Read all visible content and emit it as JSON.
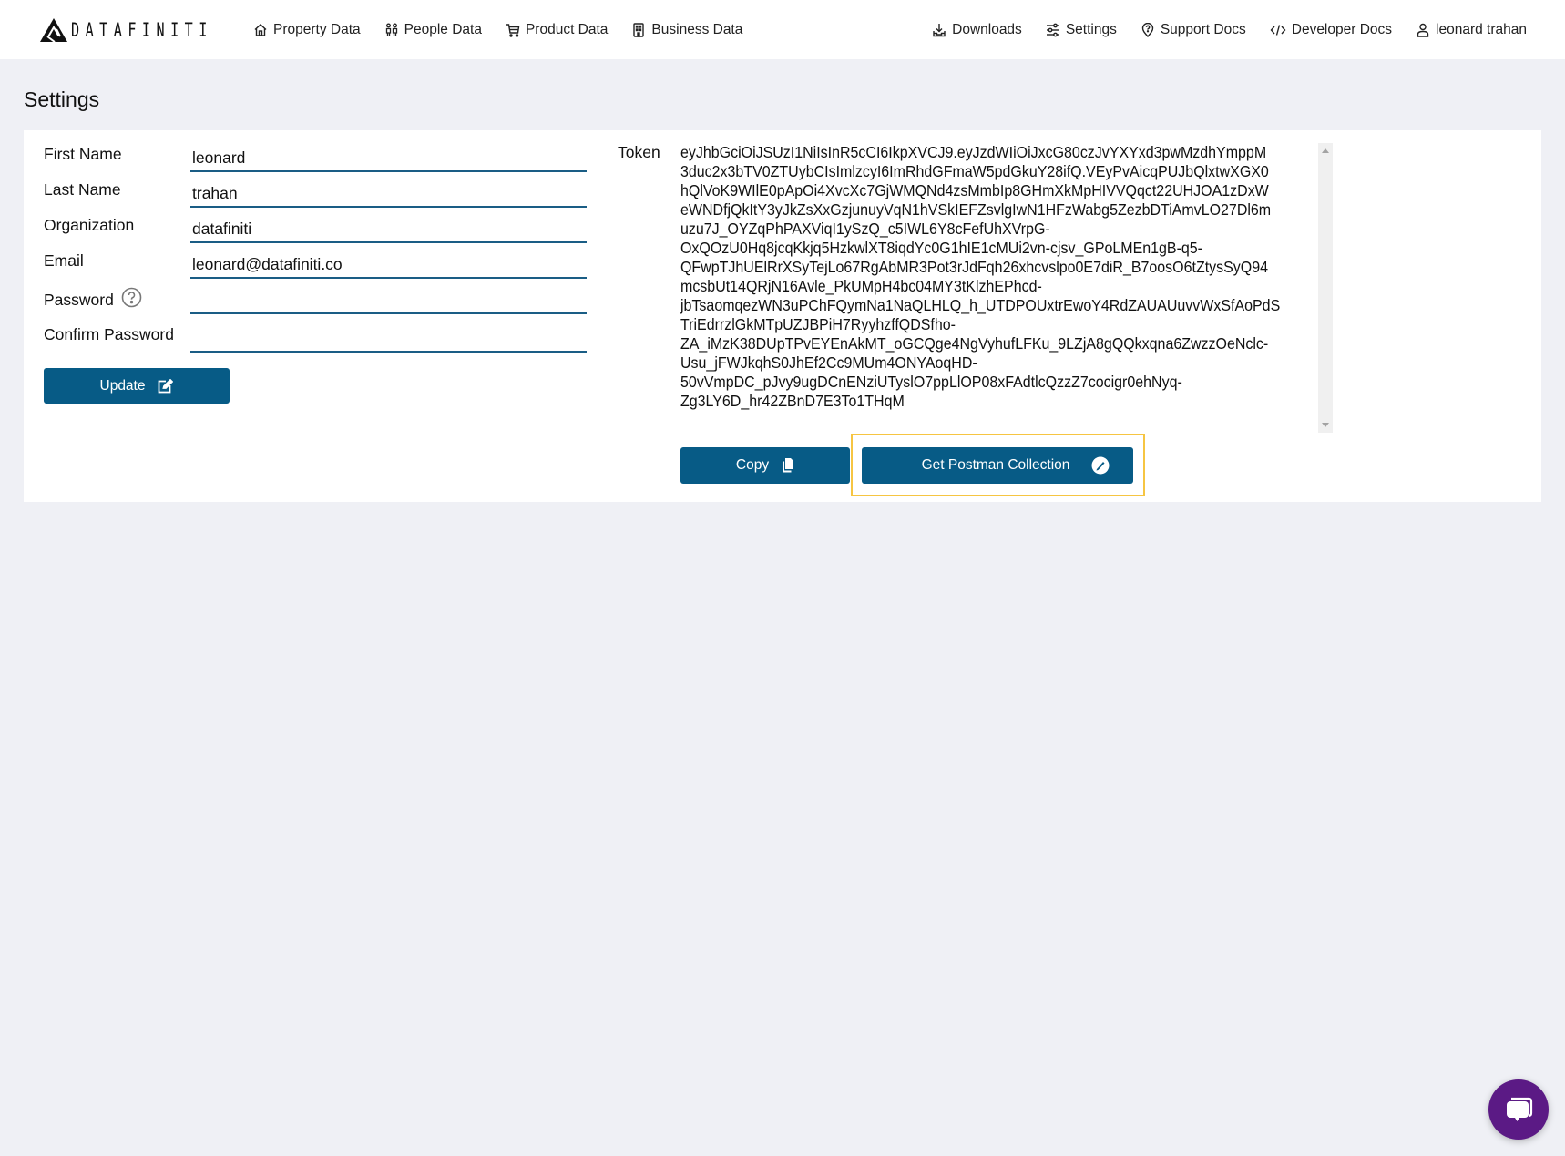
{
  "brand": {
    "name": "DATAFINITI"
  },
  "nav": {
    "left": [
      {
        "label": "Property Data",
        "icon": "home-icon"
      },
      {
        "label": "People Data",
        "icon": "people-icon"
      },
      {
        "label": "Product Data",
        "icon": "cart-icon"
      },
      {
        "label": "Business Data",
        "icon": "building-icon"
      }
    ],
    "right": [
      {
        "label": "Downloads",
        "icon": "download-icon"
      },
      {
        "label": "Settings",
        "icon": "sliders-icon"
      },
      {
        "label": "Support Docs",
        "icon": "support-pin-icon"
      },
      {
        "label": "Developer Docs",
        "icon": "code-icon"
      },
      {
        "label": "leonard trahan",
        "icon": "user-icon"
      }
    ]
  },
  "page": {
    "title": "Settings"
  },
  "form": {
    "fields": [
      {
        "label": "First Name",
        "value": "leonard"
      },
      {
        "label": "Last Name",
        "value": "trahan"
      },
      {
        "label": "Organization",
        "value": "datafiniti"
      },
      {
        "label": "Email",
        "value": "leonard@datafiniti.co"
      },
      {
        "label": "Password",
        "value": ""
      },
      {
        "label": "Confirm Password",
        "value": ""
      }
    ],
    "update_label": "Update"
  },
  "token": {
    "label": "Token",
    "value": "eyJhbGciOiJSUzI1NiIsInR5cCI6IkpXVCJ9.eyJzdWIiOiJxcG80czJvYXYxd3pwMzdhYmppM3duc2x3bTV0ZTUybCIsImlzcyI6ImRhdGFmaW5pdGkuY28ifQ.VEyPvAicqPUJbQlxtwXGX0hQlVoK9WIlE0pApOi4XvcXc7GjWMQNd4zsMmbIp8GHmXkMpHIVVQqct22UHJOA1zDxWeWNDfjQkItY3yJkZsXxGzjunuyVqN1hVSkIEFZsvlgIwN1HFzWabg5ZezbDTiAmvLO27Dl6muzu7J_OYZqPhPAXViqI1ySzQ_c5IWL6Y8cFefUhXVrpG-OxQOzU0Hq8jcqKkjq5HzkwlXT8iqdYc0G1hIE1cMUi2vn-cjsv_GPoLMEn1gB-q5-QFwpTJhUElRrXSyTejLo67RgAbMR3Pot3rJdFqh26xhcvslpo0E7diR_B7oosO6tZtysSyQ94mcsbUt14QRjN16Avle_PkUMpH4bc04MY3tKlzhEPhcd-jbTsaomqezWN3uPChFQymNa1NaQLHLQ_h_UTDPOUxtrEwoY4RdZAUAUuvvWxSfAoPdSTriEdrrzlGkMTpUZJBPiH7RyyhzffQDSfho-ZA_iMzK38DUpTPvEYEnAkMT_oGCQge4NgVyhufLFKu_9LZjA8gQQkxqna6ZwzzOeNclc-Usu_jFWJkqhS0JhEf2Cc9MUm4ONYAoqHD-50vVmpDC_pJvy9ugDCnENziUTyslO7ppLlOP08xFAdtlcQzzZ7cocigr0ehNyq-Zg3LY6D_hr42ZBnD7E3To1THqM",
    "lines": [
      "eyJhbGciOiJSUzI1NiIsInR5cCI6IkpXVCJ9.eyJzdWIiOiJxcG80czJvYXYxd3pwMzdhYmppM",
      "3duc2x3bTV0ZTUybCIsImlzcyI6ImRhdGFmaW5pdGkuY28ifQ.VEyPvAicqPUJbQlxtwXGX0",
      "hQlVoK9WIlE0pApOi4XvcXc7GjWMQNd4zsMmbIp8GHmXkMpHIVVQqct22UHJOA1zDxW",
      "eWNDfjQkItY3yJkZsXxGzjunuyVqN1hVSkIEFZsvlgIwN1HFzWabg5ZezbDTiAmvLO27Dl6m",
      "uzu7J_OYZqPhPAXViqI1ySzQ_c5IWL6Y8cFefUhXVrpG-",
      "OxQOzU0Hq8jcqKkjq5HzkwlXT8iqdYc0G1hIE1cMUi2vn-cjsv_GPoLMEn1gB-q5-",
      "QFwpTJhUElRrXSyTejLo67RgAbMR3Pot3rJdFqh26xhcvslpo0E7diR_B7oosO6tZtysSyQ94",
      "mcsbUt14QRjN16Avle_PkUMpH4bc04MY3tKlzhEPhcd-",
      "jbTsaomqezWN3uPChFQymNa1NaQLHLQ_h_UTDPOUxtrEwoY4RdZAUAUuvvWxSfAoPdS",
      "TriEdrrzlGkMTpUZJBPiH7RyyhzffQDSfho-",
      "ZA_iMzK38DUpTPvEYEnAkMT_oGCQge4NgVyhufLFKu_9LZjA8gQQkxqna6ZwzzOeNclc-",
      "Usu_jFWJkqhS0JhEf2Cc9MUm4ONYAoqHD-",
      "50vVmpDC_pJvy9ugDCnENziUTyslO7ppLlOP08xFAdtlcQzzZ7cocigr0ehNyq-",
      "Zg3LY6D_hr42ZBnD7E3To1THqM"
    ],
    "copy_label": "Copy",
    "postman_label": "Get Postman Collection"
  },
  "colors": {
    "primary": "#075b86",
    "highlight": "#f6c542",
    "chat": "#5b1a85",
    "background": "#eff0f5"
  }
}
